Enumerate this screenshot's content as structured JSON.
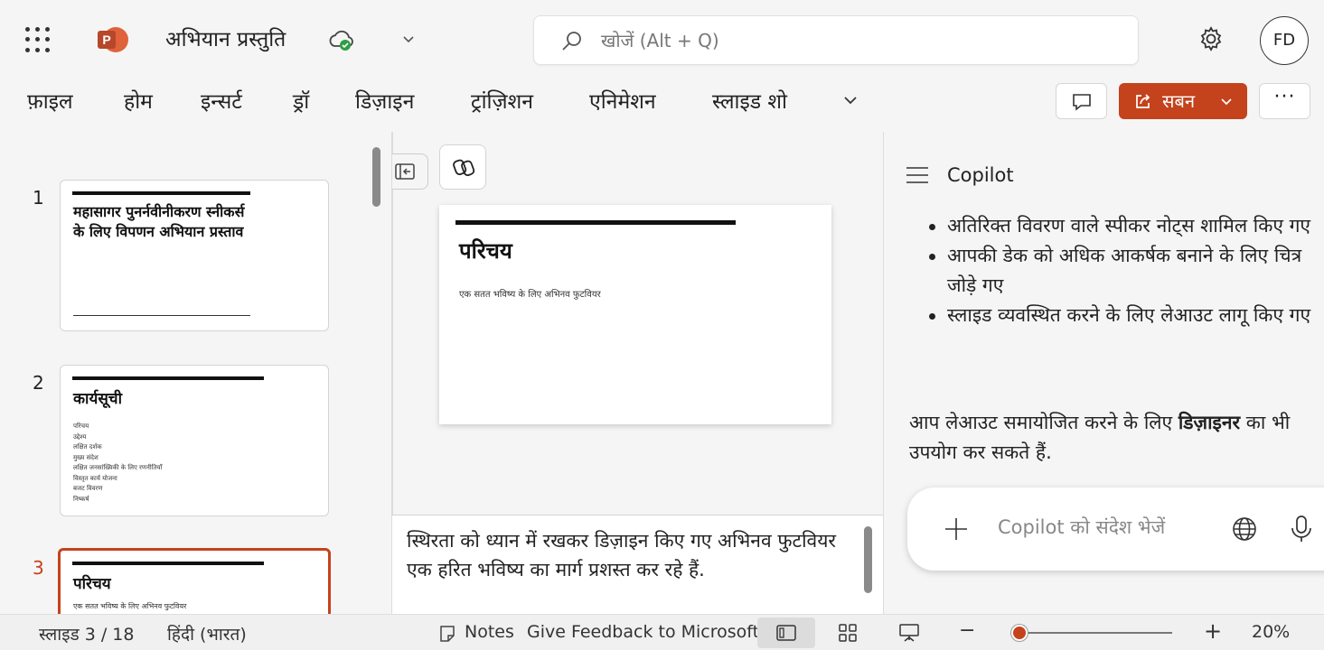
{
  "titlebar": {
    "doc_title": "अभियान प्रस्तुति",
    "search_placeholder": "खोजें (Alt + Q)",
    "avatar_initials": "FD"
  },
  "ribbon": {
    "tabs": [
      "फ़ाइल",
      "होम",
      "इन्सर्ट",
      "ड्रॉ",
      "डिज़ाइन",
      "ट्रांज़िशन",
      "एनिमेशन",
      "स्लाइड शो"
    ],
    "share_label": "सबन",
    "more_label": "···"
  },
  "thumbnails": [
    {
      "number": "1",
      "title": "महासागर पुनर्नवीनीकरण स्नीकर्स के लिए विपणन अभियान प्रस्ताव"
    },
    {
      "number": "2",
      "title": "कार्यसूची",
      "items": [
        "परिचय",
        "उद्देश्य",
        "लक्षित दर्शक",
        "मुख्य संदेश",
        "लक्षित जनसांख्यिकी के लिए रणनीतियाँ",
        "विस्तृत कार्य योजना",
        "बजट विवरण",
        "निष्कर्ष"
      ]
    },
    {
      "number": "3",
      "title": "परिचय",
      "subtitle": "एक सतत भविष्य के लिए अभिनव फुटवियर"
    }
  ],
  "slide": {
    "title": "परिचय",
    "subtitle": "एक सतत भविष्य के लिए अभिनव फुटवियर"
  },
  "notes": {
    "text": "स्थिरता को ध्यान में रखकर डिज़ाइन किए गए अभिनव फुटवियर एक हरित भविष्य का मार्ग प्रशस्त कर रहे हैं."
  },
  "copilot": {
    "title": "Copilot",
    "bullets": [
      "अतिरिक्त विवरण वाले स्पीकर नोट्स शामिल किए गए",
      "आपकी डेक को अधिक आकर्षक बनाने के लिए चित्र जोड़े गए",
      "स्लाइड व्यवस्थित करने के लिए लेआउट लागू किए गए"
    ],
    "para_before": "आप लेआउट समायोजित करने के लिए ",
    "para_bold": "डिज़ाइनर",
    "para_after": " का भी उपयोग कर सकते हैं.",
    "input_placeholder": "Copilot को संदेश भेजें"
  },
  "statusbar": {
    "slide_counter": "स्लाइड 3 / 18",
    "language": "हिंदी (भारत)",
    "notes_label": "Notes",
    "feedback_label": "Give Feedback to Microsoft",
    "zoom_out": "−",
    "zoom_in": "+",
    "zoom_level": "20%"
  },
  "colors": {
    "accent": "#c4421c",
    "cloud_ok": "#2e9e44"
  },
  "icons": [
    "app-launcher-icon",
    "powerpoint-logo",
    "cloud-saved-icon",
    "search-icon",
    "gear-icon",
    "comment-icon",
    "share-icon",
    "chevron-down-icon",
    "collapse-pane-icon",
    "copilot-icon",
    "hamburger-icon",
    "plus-icon",
    "globe-icon",
    "microphone-icon",
    "notes-icon",
    "normal-view-icon",
    "slide-sorter-icon",
    "presenter-icon"
  ]
}
